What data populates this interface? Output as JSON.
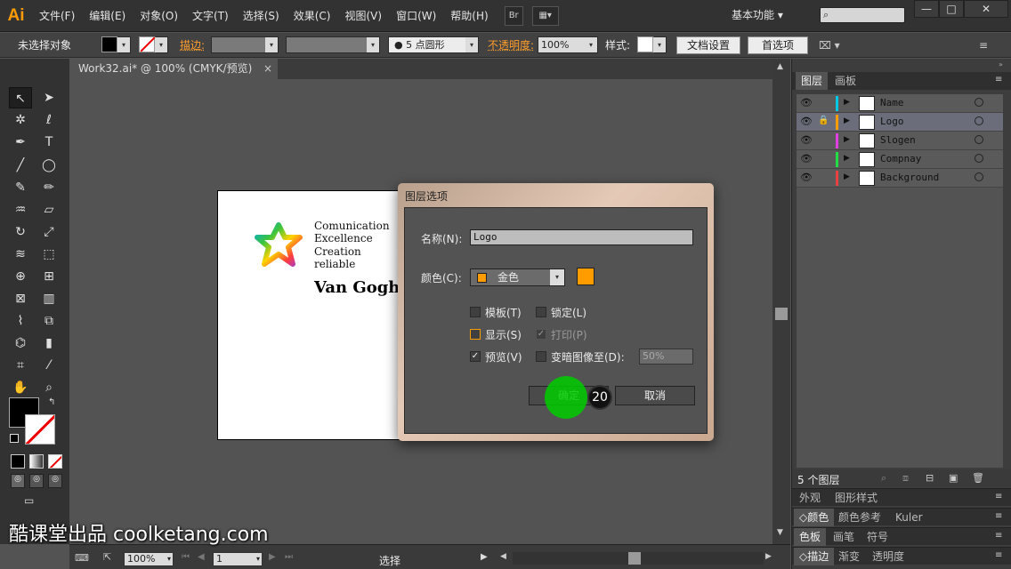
{
  "app": {
    "logo": "Ai",
    "menu": [
      "文件(F)",
      "编辑(E)",
      "对象(O)",
      "文字(T)",
      "选择(S)",
      "效果(C)",
      "视图(V)",
      "窗口(W)",
      "帮助(H)"
    ],
    "bridge": "Br",
    "workspace": "基本功能",
    "window_controls": [
      "—",
      "□",
      "✕"
    ]
  },
  "controlbar": {
    "selection": "未选择对象",
    "stroke_label": "描边:",
    "brush": "5 点圆形",
    "opacity_label": "不透明度:",
    "opacity_value": "100%",
    "style_label": "样式:",
    "doc_settings": "文档设置",
    "preferences": "首选项"
  },
  "document": {
    "tab_title": "Work32.ai* @ 100% (CMYK/预览)",
    "close": "×"
  },
  "artboard": {
    "slogan": [
      "Comunication",
      "Excellence",
      "Creation",
      "reliable"
    ],
    "brand": "Van Gogh"
  },
  "statusbar": {
    "zoom": "100%",
    "page": "1",
    "tool": "选择"
  },
  "layers_panel": {
    "tabs": [
      "图层",
      "画板"
    ],
    "layers": [
      {
        "name": "Name",
        "color": "#00c8e6",
        "selected": false,
        "locked": false
      },
      {
        "name": "Logo",
        "color": "#ff9c00",
        "selected": true,
        "locked": true
      },
      {
        "name": "Slogen",
        "color": "#e040e0",
        "selected": false,
        "locked": false
      },
      {
        "name": "Compnay",
        "color": "#22dd44",
        "selected": false,
        "locked": false
      },
      {
        "name": "Background",
        "color": "#e84040",
        "selected": false,
        "locked": false
      }
    ],
    "count": "5 个图层"
  },
  "panels": {
    "appearance": [
      "外观",
      "图形样式"
    ],
    "color": [
      "颜色",
      "颜色参考",
      "Kuler"
    ],
    "swatches": [
      "色板",
      "画笔",
      "符号"
    ],
    "stroke": [
      "描边",
      "渐变",
      "透明度"
    ]
  },
  "dialog": {
    "title": "图层选项",
    "name_label": "名称(N):",
    "name_value": "Logo",
    "color_label": "颜色(C):",
    "color_value": "金色",
    "color_hex": "#ff9c00",
    "template": "模板(T)",
    "lock": "锁定(L)",
    "show": "显示(S)",
    "print": "打印(P)",
    "preview": "预览(V)",
    "dim": "变暗图像至(D):",
    "dim_value": "50%",
    "ok": "确定",
    "cancel": "取消"
  },
  "overlay": {
    "step": "20",
    "watermark": "酷课堂出品 coolketang.com"
  }
}
